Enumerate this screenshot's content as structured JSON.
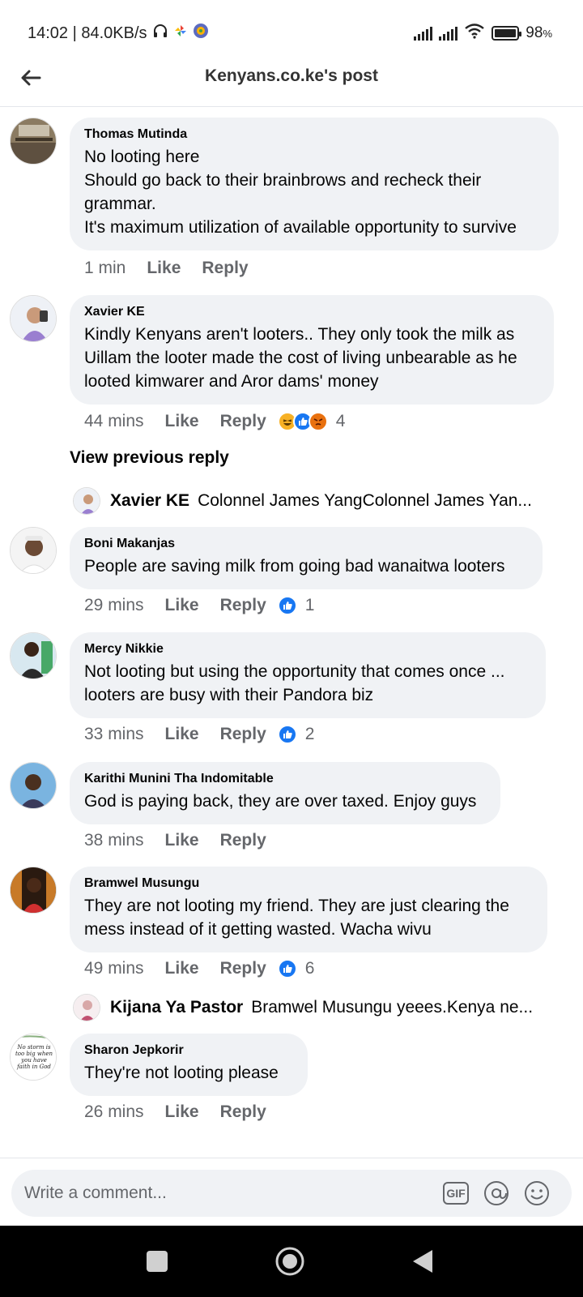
{
  "status_bar": {
    "time_speed": "14:02 | 84.0KB/s",
    "battery": "98",
    "battery_unit": "%"
  },
  "header": {
    "title": "Kenyans.co.ke's post"
  },
  "comments": [
    {
      "author": "Thomas Mutinda",
      "text": "No looting here\nShould go back to their brainbrows and recheck their grammar.\nIt's maximum utilization of available opportunity to survive",
      "time": "1 min",
      "like": "Like",
      "reply": "Reply",
      "reaction_count": ""
    },
    {
      "author": "Xavier KE",
      "text": "Kindly Kenyans aren't looters.. They only took the milk as Uillam the looter made the cost of living unbearable as he looted kimwarer and Aror dams' money",
      "time": "44 mins",
      "like": "Like",
      "reply": "Reply",
      "reaction_count": "4",
      "reactions": [
        "haha",
        "like",
        "angry"
      ]
    },
    {
      "author": "Boni Makanjas",
      "text": "People are saving milk from going bad wanaitwa looters",
      "time": "29 mins",
      "like": "Like",
      "reply": "Reply",
      "reaction_count": "1",
      "reactions": [
        "like"
      ]
    },
    {
      "author": "Mercy Nikkie",
      "text": "Not looting but using the opportunity that comes once ...\nlooters are busy with their Pandora biz",
      "time": "33 mins",
      "like": "Like",
      "reply": "Reply",
      "reaction_count": "2",
      "reactions": [
        "like"
      ]
    },
    {
      "author": "Karithi Munini Tha Indomitable",
      "text": "God is paying back, they are over taxed. Enjoy guys",
      "time": "38 mins",
      "like": "Like",
      "reply": "Reply",
      "reaction_count": ""
    },
    {
      "author": "Bramwel Musungu",
      "text": "They are not looting my friend.  They are just clearing the mess instead of it getting wasted. Wacha wivu",
      "time": "49 mins",
      "like": "Like",
      "reply": "Reply",
      "reaction_count": "6",
      "reactions": [
        "like"
      ]
    },
    {
      "author": "Sharon Jepkorir",
      "text": "They're not looting please",
      "time": "26 mins",
      "like": "Like",
      "reply": "Reply",
      "reaction_count": "",
      "avatar_text": "No storm is too big when you have faith in God"
    }
  ],
  "view_previous_reply": "View previous reply",
  "reply_previews": [
    {
      "author": "Xavier KE",
      "text": "Colonnel James YangColonnel James Yan..."
    },
    {
      "author": "Kijana Ya Pastor",
      "text": "Bramwel Musungu yeees.Kenya ne..."
    }
  ],
  "composer": {
    "placeholder": "Write a comment...",
    "gif_label": "GIF"
  },
  "colors": {
    "bubble": "#f0f2f5",
    "meta": "#65676b",
    "like_blue": "#1877f2"
  }
}
